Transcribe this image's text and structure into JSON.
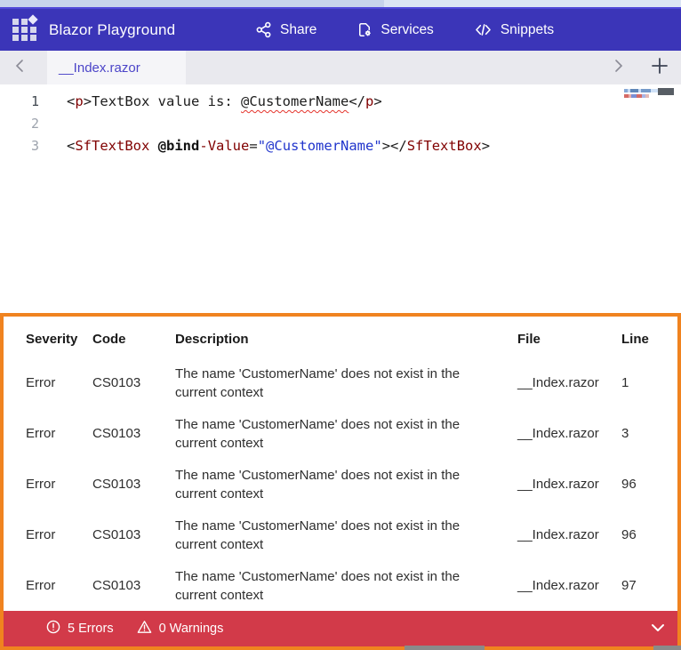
{
  "colors": {
    "navbar_bg": "#3b35b8",
    "tab_text": "#4b44c8",
    "tag_token": "#800000",
    "string_token": "#2135cc",
    "error_squiggle": "#e5342c",
    "panel_border": "#f0831f",
    "status_bar_bg": "#d23a49"
  },
  "navbar": {
    "title": "Blazor Playground",
    "items": [
      {
        "label": "Share",
        "icon": "share-nodes-icon"
      },
      {
        "label": "Services",
        "icon": "file-gear-icon"
      },
      {
        "label": "Snippets",
        "icon": "code-icon"
      }
    ]
  },
  "tabbar": {
    "active_tab": "__Index.razor"
  },
  "editor": {
    "line_numbers": [
      "1",
      "2",
      "3"
    ],
    "lines": [
      [
        {
          "t": "<",
          "c": "delim"
        },
        {
          "t": "p",
          "c": "tag"
        },
        {
          "t": ">",
          "c": "delim"
        },
        {
          "t": "TextBox value is: ",
          "c": "plain"
        },
        {
          "t": "@CustomerName",
          "c": "plain squiggle"
        },
        {
          "t": "</",
          "c": "delim"
        },
        {
          "t": "p",
          "c": "tag"
        },
        {
          "t": ">",
          "c": "delim"
        }
      ],
      [],
      [
        {
          "t": "<",
          "c": "delim"
        },
        {
          "t": "SfTextBox",
          "c": "tag"
        },
        {
          "t": " ",
          "c": "plain"
        },
        {
          "t": "@bind",
          "c": "keyword"
        },
        {
          "t": "-Value",
          "c": "tag"
        },
        {
          "t": "=",
          "c": "delim"
        },
        {
          "t": "\"@CustomerName\"",
          "c": "string"
        },
        {
          "t": ">",
          "c": "delim"
        },
        {
          "t": "</",
          "c": "delim"
        },
        {
          "t": "SfTextBox",
          "c": "tag"
        },
        {
          "t": ">",
          "c": "delim"
        }
      ]
    ]
  },
  "error_panel": {
    "columns": {
      "severity": "Severity",
      "code": "Code",
      "description": "Description",
      "file": "File",
      "line": "Line"
    },
    "rows": [
      {
        "severity": "Error",
        "code": "CS0103",
        "description": "The name 'CustomerName' does not exist in the current context",
        "file": "__Index.razor",
        "line": "1"
      },
      {
        "severity": "Error",
        "code": "CS0103",
        "description": "The name 'CustomerName' does not exist in the current context",
        "file": "__Index.razor",
        "line": "3"
      },
      {
        "severity": "Error",
        "code": "CS0103",
        "description": "The name 'CustomerName' does not exist in the current context",
        "file": "__Index.razor",
        "line": "96"
      },
      {
        "severity": "Error",
        "code": "CS0103",
        "description": "The name 'CustomerName' does not exist in the current context",
        "file": "__Index.razor",
        "line": "96"
      },
      {
        "severity": "Error",
        "code": "CS0103",
        "description": "The name 'CustomerName' does not exist in the current context",
        "file": "__Index.razor",
        "line": "97"
      }
    ]
  },
  "status_bar": {
    "errors_label": "5 Errors",
    "warnings_label": "0 Warnings"
  }
}
